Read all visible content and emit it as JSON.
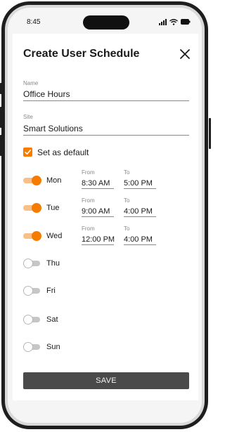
{
  "status_bar": {
    "time": "8:45"
  },
  "form": {
    "title": "Create User Schedule",
    "name": {
      "label": "Name",
      "value": "Office Hours"
    },
    "site": {
      "label": "Site",
      "value": "Smart Solutions"
    },
    "default_checkbox": {
      "label": "Set as default",
      "checked": true
    },
    "days": [
      {
        "day": "Mon",
        "enabled": true,
        "from_label": "From",
        "from": "8:30 AM",
        "to_label": "To",
        "to": "5:00 PM"
      },
      {
        "day": "Tue",
        "enabled": true,
        "from_label": "From",
        "from": "9:00 AM",
        "to_label": "To",
        "to": "4:00 PM"
      },
      {
        "day": "Wed",
        "enabled": true,
        "from_label": "From",
        "from": "12:00 PM",
        "to_label": "To",
        "to": "4:00 PM"
      },
      {
        "day": "Thu",
        "enabled": false
      },
      {
        "day": "Fri",
        "enabled": false
      },
      {
        "day": "Sat",
        "enabled": false
      },
      {
        "day": "Sun",
        "enabled": false
      }
    ],
    "save_label": "SAVE"
  },
  "colors": {
    "accent": "#f57c00",
    "accent_light": "#f8bf86",
    "save_button": "#4a4a4a"
  },
  "icons": {
    "close": "close-icon",
    "checkbox": "checkmark-icon",
    "signal": "signal-icon",
    "wifi": "wifi-icon",
    "battery": "battery-icon"
  }
}
